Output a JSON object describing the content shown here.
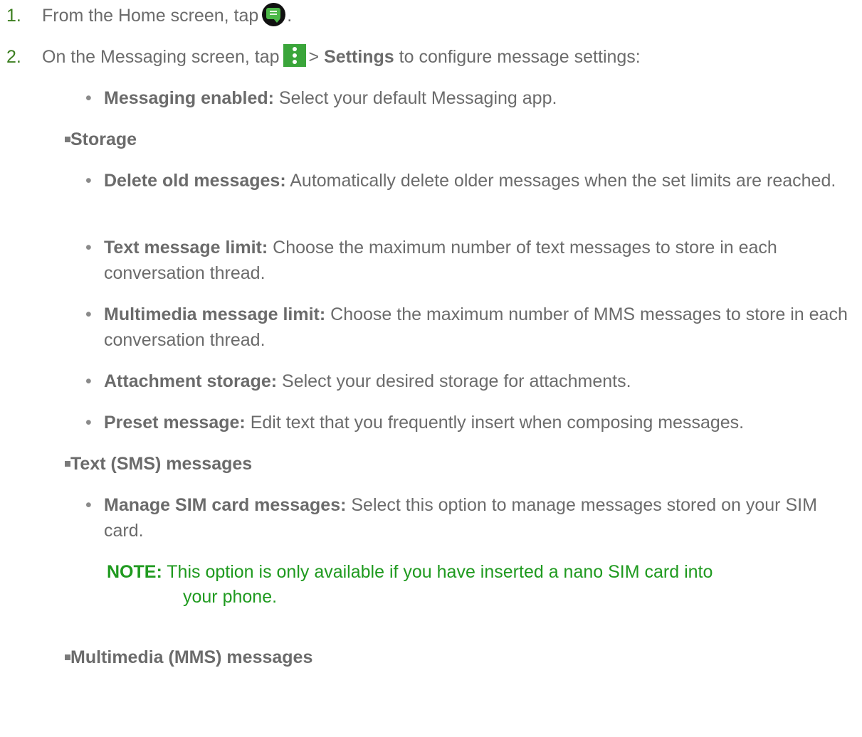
{
  "steps": [
    {
      "number": "1.",
      "text_before": "From the Home screen, tap",
      "text_after": ".",
      "icon": "messaging-app-icon"
    },
    {
      "number": "2.",
      "text_before": "On the Messaging screen, tap",
      "sep": ">",
      "bold": "Settings",
      "text_after": "to configure message settings:",
      "icon": "menu-dots-icon"
    }
  ],
  "top_item": {
    "term": "Messaging enabled:",
    "desc": "Select your default Messaging app."
  },
  "sections": [
    {
      "heading": "Storage",
      "items": [
        {
          "term": "Delete old messages:",
          "desc": "Automatically delete older messages when the set limits are reached."
        },
        {
          "term": "Text message limit:",
          "desc": "Choose the maximum number of text messages to store in each conversation thread."
        },
        {
          "term": "Multimedia message limit:",
          "desc": "Choose the maximum number of MMS messages to store in each conversation thread."
        },
        {
          "term": "Attachment storage:",
          "desc": "Select your desired storage for attachments."
        },
        {
          "term": "Preset message:",
          "desc": "Edit text that you frequently insert when composing messages."
        }
      ]
    },
    {
      "heading": "Text (SMS) messages",
      "items": [
        {
          "term": "Manage SIM card messages:",
          "desc": "Select this option to manage messages stored on your SIM card."
        }
      ],
      "note": {
        "label": "NOTE:",
        "line1": "This option is only available if you have inserted a nano SIM card into",
        "line2": "your phone."
      }
    },
    {
      "heading": "Multimedia (MMS) messages"
    }
  ],
  "bullets": {
    "item": "•"
  },
  "colors": {
    "text": "#6b6b6b",
    "step_number": "#3a7d1e",
    "note": "#1f9a1f",
    "icon_green": "#3aa53a"
  }
}
